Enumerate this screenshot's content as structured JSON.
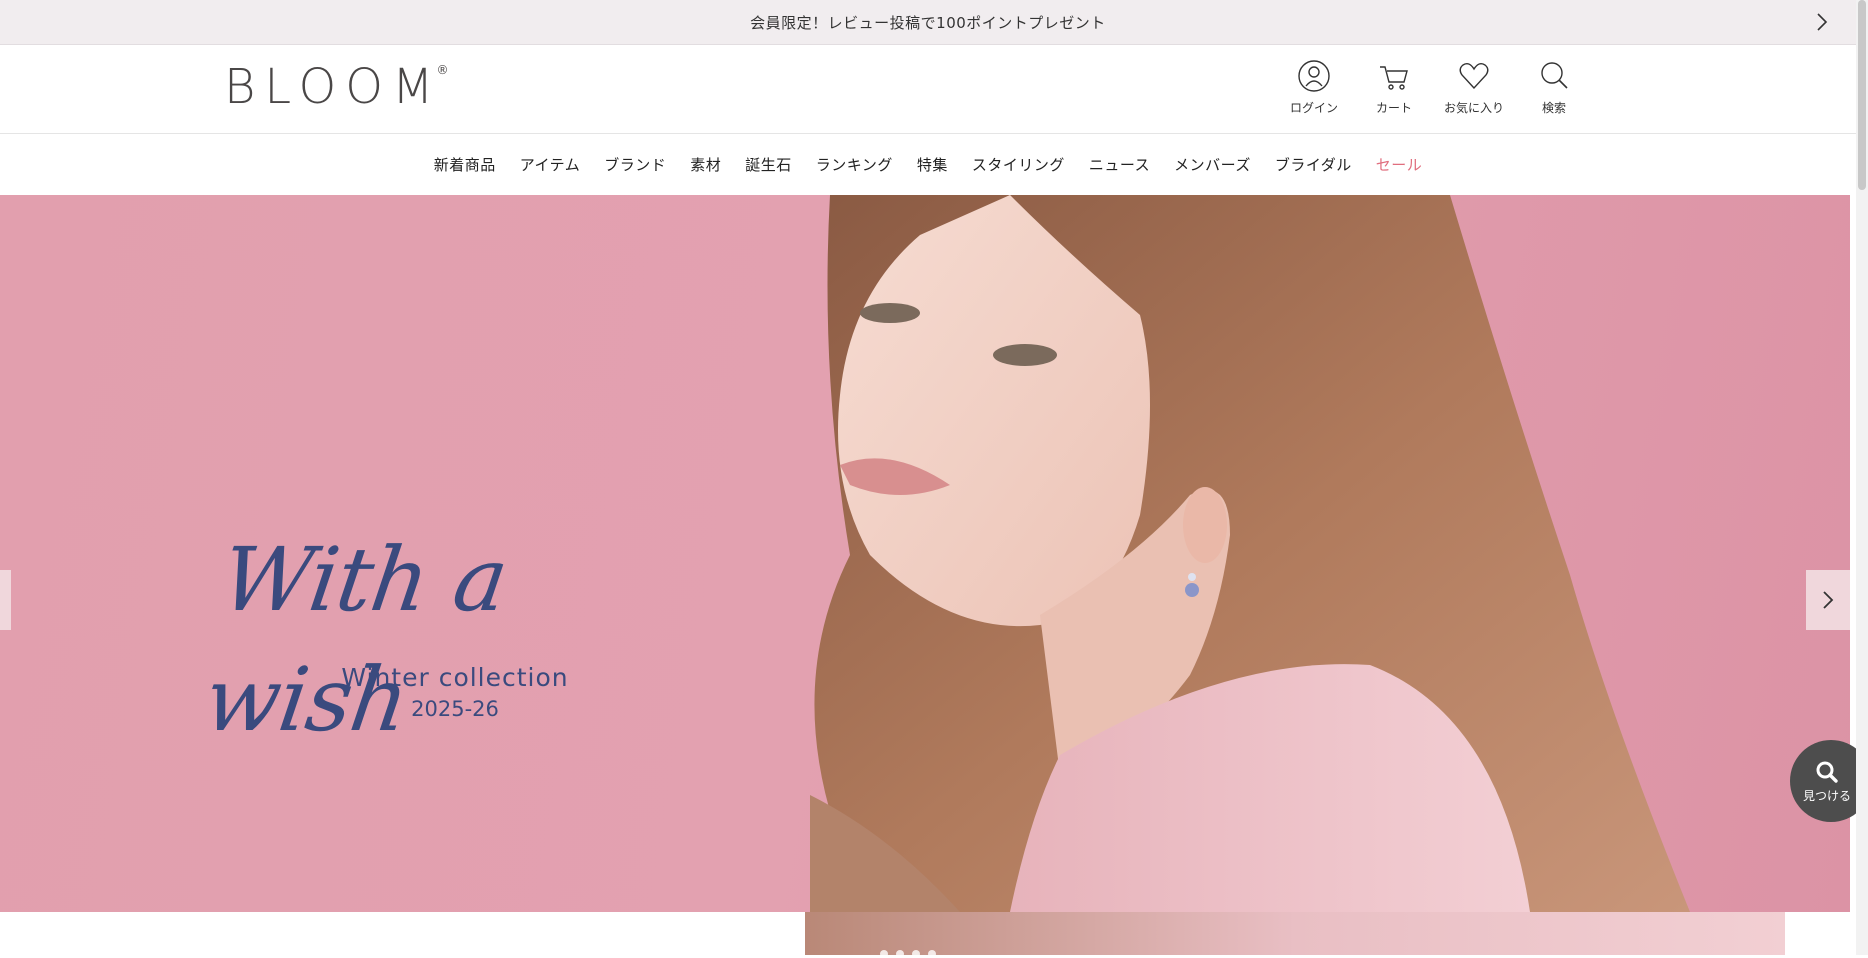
{
  "announcement": {
    "text": "会員限定！レビュー投稿で100ポイントプレゼント",
    "next_icon": "chevron-right-icon"
  },
  "header": {
    "logo_text": "BLOOM",
    "logo_mark": "®",
    "icons": [
      {
        "name": "user-icon",
        "label": "ログイン"
      },
      {
        "name": "cart-icon",
        "label": "カート"
      },
      {
        "name": "heart-icon",
        "label": "お気に入り"
      },
      {
        "name": "search-icon",
        "label": "検索"
      }
    ]
  },
  "nav": {
    "items": [
      "新着商品",
      "アイテム",
      "ブランド",
      "素材",
      "誕生石",
      "ランキング",
      "特集",
      "スタイリング",
      "ニュース",
      "メンバーズ",
      "ブライダル",
      "セール"
    ],
    "sale_color": "#e06e7e"
  },
  "hero": {
    "script_text": "With a wish",
    "subtitle": "Winter collection",
    "year": "2025-26",
    "text_color": "#3a4a7e",
    "background_color": "#e3a1b0"
  },
  "floating": {
    "find_label": "見つける",
    "find_icon": "search-icon"
  }
}
